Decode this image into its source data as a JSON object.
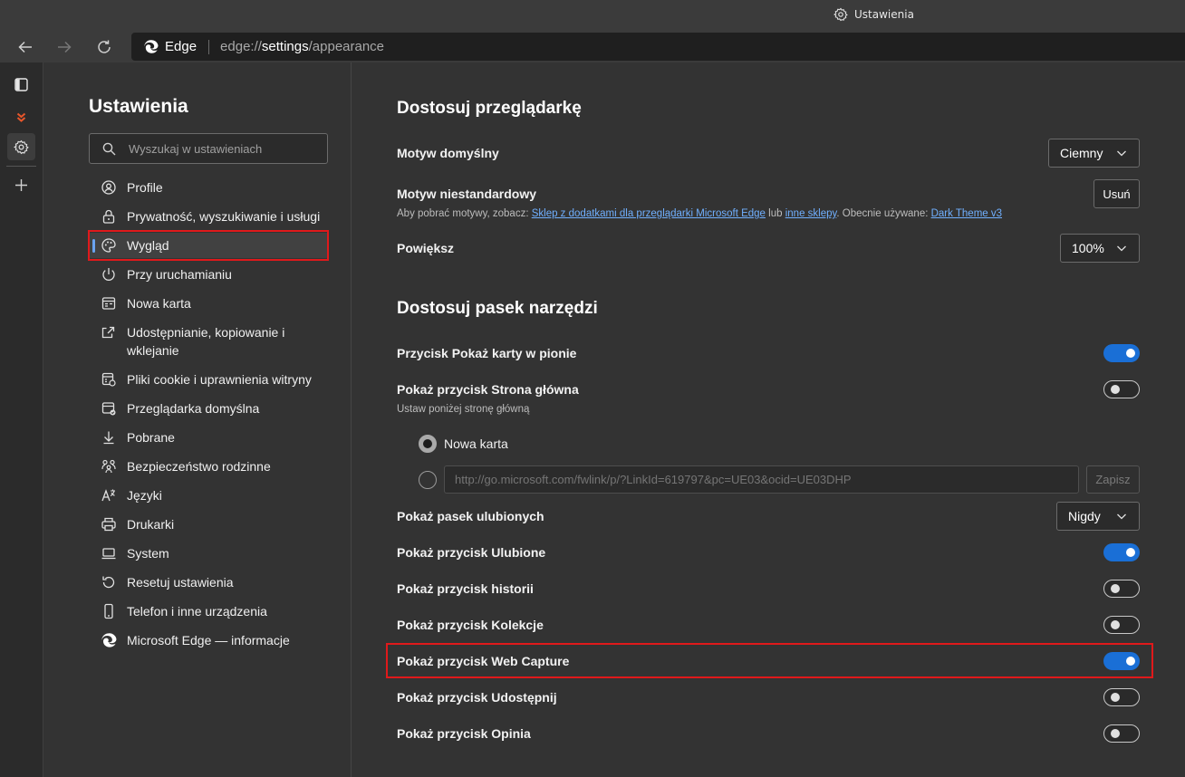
{
  "window": {
    "title": "Ustawienia"
  },
  "address": {
    "site_label": "Edge",
    "url_prefix": "edge://",
    "url_host": "settings",
    "url_path": "/appearance"
  },
  "sidebar": {
    "title": "Ustawienia",
    "search_placeholder": "Wyszukaj w ustawieniach",
    "items": [
      {
        "label": "Profile",
        "icon": "profile-icon"
      },
      {
        "label": "Prywatność, wyszukiwanie i usługi",
        "icon": "lock-icon"
      },
      {
        "label": "Wygląd",
        "icon": "palette-icon",
        "selected": true
      },
      {
        "label": "Przy uruchamianiu",
        "icon": "power-icon"
      },
      {
        "label": "Nowa karta",
        "icon": "new-tab-icon"
      },
      {
        "label": "Udostępnianie, kopiowanie i wklejanie",
        "icon": "share-icon"
      },
      {
        "label": "Pliki cookie i uprawnienia witryny",
        "icon": "cookie-permissions-icon"
      },
      {
        "label": "Przeglądarka domyślna",
        "icon": "default-browser-icon"
      },
      {
        "label": "Pobrane",
        "icon": "download-icon"
      },
      {
        "label": "Bezpieczeństwo rodzinne",
        "icon": "family-icon"
      },
      {
        "label": "Języki",
        "icon": "languages-icon"
      },
      {
        "label": "Drukarki",
        "icon": "printer-icon"
      },
      {
        "label": "System",
        "icon": "laptop-icon"
      },
      {
        "label": "Resetuj ustawienia",
        "icon": "reset-icon"
      },
      {
        "label": "Telefon i inne urządzenia",
        "icon": "phone-icon"
      },
      {
        "label": "Microsoft Edge — informacje",
        "icon": "edge-logo-icon"
      }
    ]
  },
  "main": {
    "section1": {
      "title": "Dostosuj przeglądarkę",
      "default_theme": {
        "label": "Motyw domyślny",
        "value": "Ciemny"
      },
      "custom_theme": {
        "label": "Motyw niestandardowy",
        "button": "Usuń",
        "sub_prefix": "Aby pobrać motywy, zobacz: ",
        "link1": "Sklep z dodatkami dla przeglądarki Microsoft Edge",
        "sub_mid": " lub ",
        "link2": "inne sklepy",
        "sub_mid2": ". Obecnie używane: ",
        "link3": "Dark Theme v3"
      },
      "zoom": {
        "label": "Powiększ",
        "value": "100%"
      }
    },
    "section2": {
      "title": "Dostosuj pasek narzędzi",
      "vertical_tabs": {
        "label": "Przycisk Pokaż karty w pionie",
        "on": true
      },
      "home_button": {
        "label": "Pokaż przycisk Strona główna",
        "on": false,
        "sub": "Ustaw poniżej stronę główną"
      },
      "home_option_new_tab": "Nowa karta",
      "home_url_placeholder": "http://go.microsoft.com/fwlink/p/?LinkId=619797&pc=UE03&ocid=UE03DHP",
      "home_save": "Zapisz",
      "favorites_bar": {
        "label": "Pokaż pasek ulubionych",
        "value": "Nigdy"
      },
      "favorites_button": {
        "label": "Pokaż przycisk Ulubione",
        "on": true
      },
      "history_button": {
        "label": "Pokaż przycisk historii",
        "on": false
      },
      "collections_button": {
        "label": "Pokaż przycisk Kolekcje",
        "on": false
      },
      "web_capture_button": {
        "label": "Pokaż przycisk Web Capture",
        "on": true
      },
      "share_button": {
        "label": "Pokaż przycisk Udostępnij",
        "on": false
      },
      "feedback_button": {
        "label": "Pokaż przycisk Opinia",
        "on": false
      }
    }
  },
  "colors": {
    "accent": "#1a6fd6",
    "highlight_box": "#e0191b",
    "link": "#70b0ff"
  }
}
